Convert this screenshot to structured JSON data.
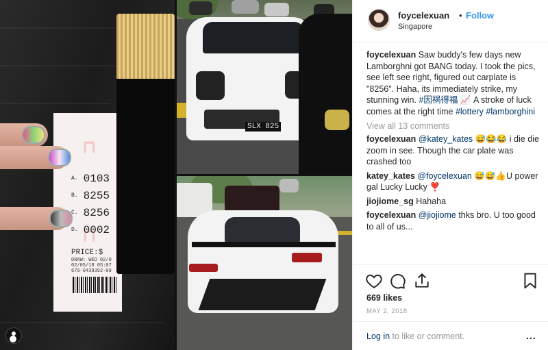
{
  "post": {
    "username": "foycelexuan",
    "separator": "•",
    "follow_label": "Follow",
    "location": "Singapore"
  },
  "caption": {
    "username": "foycelexuan",
    "text": "Saw buddy's few days new Lamborghni got BANG today. I took the pics, see left see right, figured out carplate is \"8256\". Haha, its immediately strike, my stunning win.",
    "hashtag1": "#因祸得福",
    "emoji": "📈",
    "text2": "A stroke of luck comes at the right time",
    "hashtag2": "#lottery",
    "hashtag3": "#lamborghini"
  },
  "view_all_comments": "View all 13 comments",
  "comments": [
    {
      "username": "foycelexuan",
      "mention": "@katey_kates",
      "text": "😅😂😂 i die die zoom in see. Though the car plate was crashed too"
    },
    {
      "username": "katey_kates",
      "mention": "@foycelexuan",
      "text": "😅😅👍U power gal Lucky Lucky ❣️"
    },
    {
      "username": "jiojiome_sg",
      "mention": "",
      "text": "Hahaha"
    },
    {
      "username": "foycelexuan",
      "mention": "@jiojiome",
      "text": "thks bro. U too good to all of us..."
    }
  ],
  "actions": {
    "like_icon": "heart-icon",
    "comment_icon": "comment-icon",
    "share_icon": "share-icon",
    "save_icon": "bookmark-icon"
  },
  "likes": "669 likes",
  "date": "MAY 2, 2018",
  "login": {
    "link": "Log in",
    "text": " to like or comment.",
    "more": "..."
  },
  "ticket": {
    "rows": [
      {
        "letter": "A.",
        "number": "0103"
      },
      {
        "letter": "B.",
        "number": "8255"
      },
      {
        "letter": "C.",
        "number": "8256"
      },
      {
        "letter": "D.",
        "number": "0002"
      }
    ],
    "price": "PRICE:$",
    "draw": "DRAW: WED 02/0",
    "date_line": "02/05/18 05:07",
    "serial": "679-0439392-09"
  },
  "car_front": {
    "plate": "SLX 825"
  },
  "colors": {
    "accent": "#3897f0",
    "link": "#003569",
    "text": "#262626",
    "muted": "#999999",
    "border": "#efefef"
  }
}
